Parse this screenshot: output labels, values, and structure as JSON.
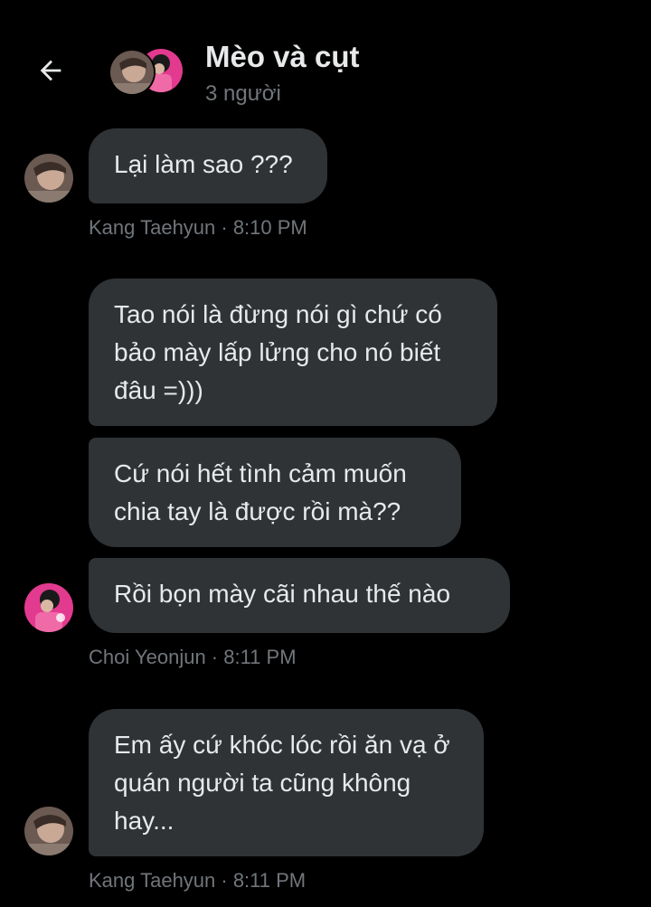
{
  "header": {
    "back_icon": "arrow-left-icon",
    "title": "Mèo và cụt",
    "subtitle": "3 người"
  },
  "messages": [
    {
      "text": "Lại làm sao ???",
      "avatar": "Kang Taehyun",
      "avatar_color": "#7a6a62"
    },
    {
      "text": "Tao nói là đừng nói gì chứ có bảo mày lấp lửng cho nó biết đâu =)))"
    },
    {
      "text": "Cứ nói hết tình cảm muốn chia tay là được rồi mà??"
    },
    {
      "text": "Rồi bọn mày cãi nhau thế nào",
      "avatar": "Choi Yeonjun",
      "avatar_color": "#e23a8f"
    },
    {
      "text": "Em ấy cứ khóc lóc rồi ăn vạ ở quán người ta cũng không hay...",
      "avatar": "Kang Taehyun"
    }
  ],
  "meta": [
    {
      "sender": "Kang Taehyun",
      "time": "8:10 PM",
      "label": "Kang Taehyun · 8:10 PM"
    },
    {
      "sender": "Choi Yeonjun",
      "time": "8:11 PM",
      "label": "Choi Yeonjun · 8:11 PM"
    },
    {
      "sender": "Kang Taehyun",
      "time": "8:11 PM",
      "label": "Kang Taehyun · 8:11 PM"
    }
  ],
  "colors": {
    "background": "#000000",
    "bubble": "#2f3336",
    "text": "#e7e9ea",
    "muted": "#71767b",
    "accent_pink": "#e23a8f"
  }
}
